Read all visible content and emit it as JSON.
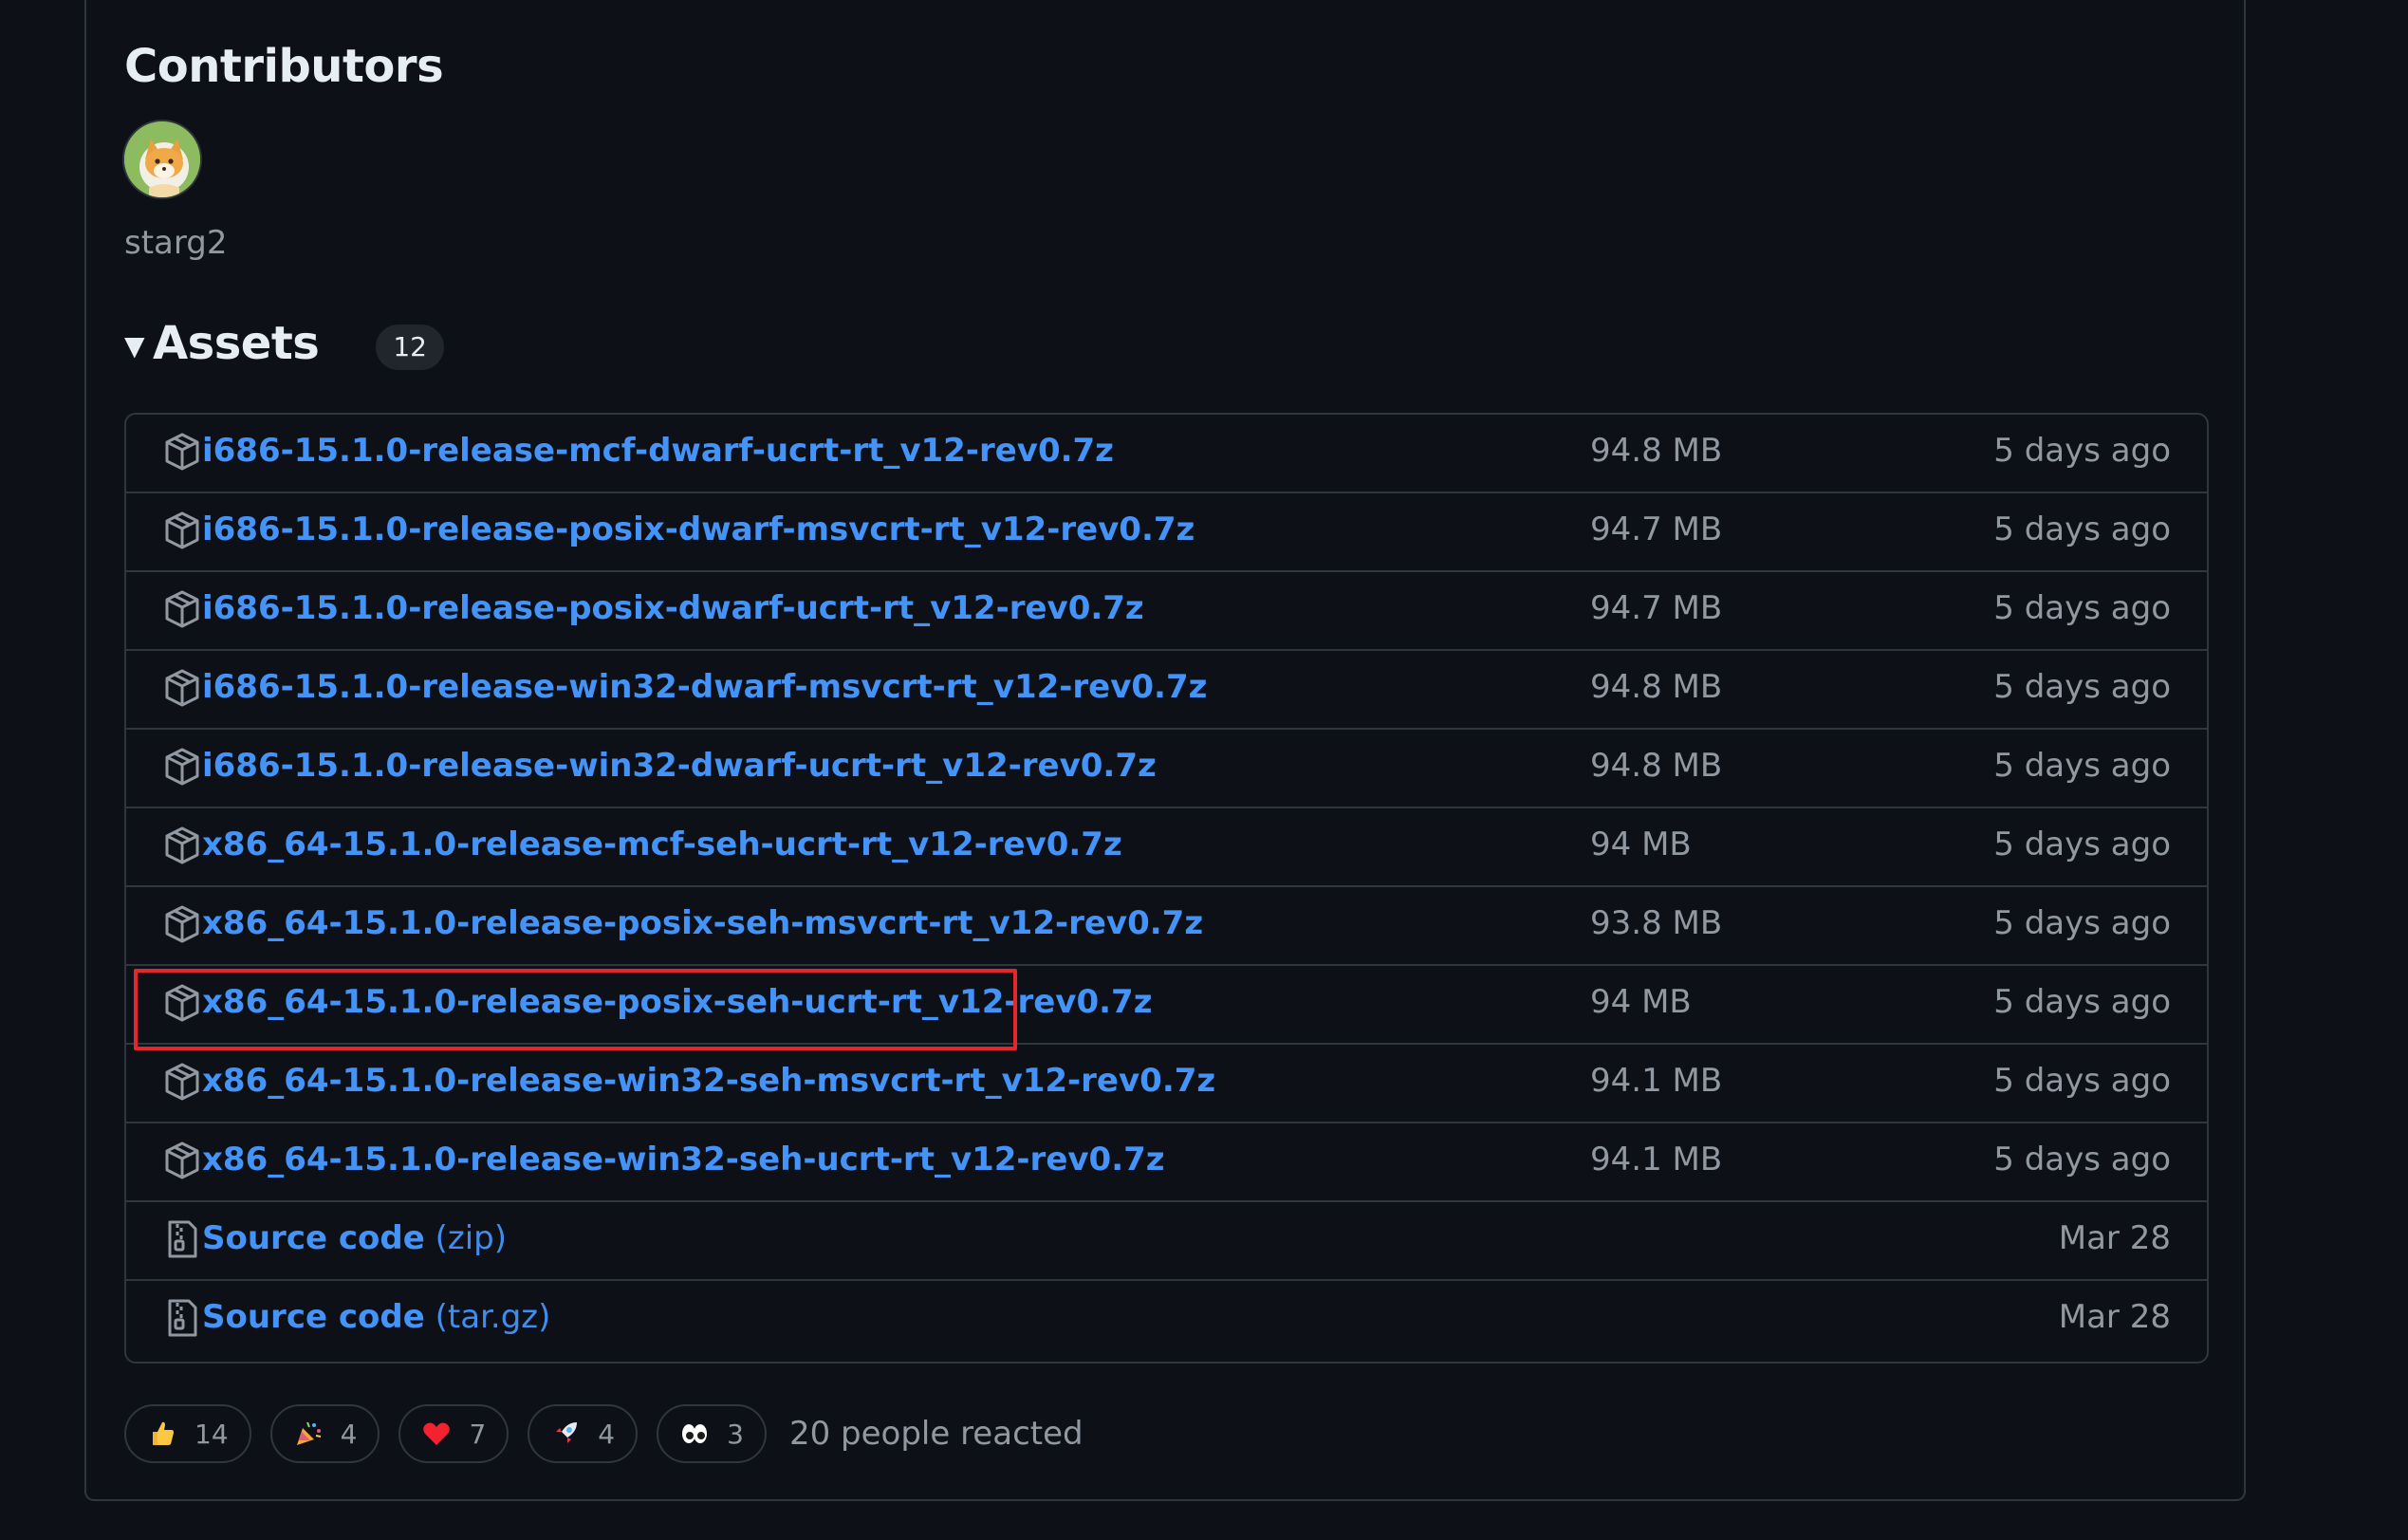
{
  "contributors": {
    "title": "Contributors",
    "users": [
      {
        "name": "starg2"
      }
    ]
  },
  "assets": {
    "title": "Assets",
    "count": "12",
    "items": [
      {
        "name": "i686-15.1.0-release-mcf-dwarf-ucrt-rt_v12-rev0.7z",
        "size": "94.8 MB",
        "date": "5 days ago",
        "icon": "package-icon"
      },
      {
        "name": "i686-15.1.0-release-posix-dwarf-msvcrt-rt_v12-rev0.7z",
        "size": "94.7 MB",
        "date": "5 days ago",
        "icon": "package-icon"
      },
      {
        "name": "i686-15.1.0-release-posix-dwarf-ucrt-rt_v12-rev0.7z",
        "size": "94.7 MB",
        "date": "5 days ago",
        "icon": "package-icon"
      },
      {
        "name": "i686-15.1.0-release-win32-dwarf-msvcrt-rt_v12-rev0.7z",
        "size": "94.8 MB",
        "date": "5 days ago",
        "icon": "package-icon"
      },
      {
        "name": "i686-15.1.0-release-win32-dwarf-ucrt-rt_v12-rev0.7z",
        "size": "94.8 MB",
        "date": "5 days ago",
        "icon": "package-icon"
      },
      {
        "name": "x86_64-15.1.0-release-mcf-seh-ucrt-rt_v12-rev0.7z",
        "size": "94 MB",
        "date": "5 days ago",
        "icon": "package-icon"
      },
      {
        "name": "x86_64-15.1.0-release-posix-seh-msvcrt-rt_v12-rev0.7z",
        "size": "93.8 MB",
        "date": "5 days ago",
        "icon": "package-icon"
      },
      {
        "name": "x86_64-15.1.0-release-posix-seh-ucrt-rt_v12-rev0.7z",
        "size": "94 MB",
        "date": "5 days ago",
        "icon": "package-icon",
        "highlighted": true
      },
      {
        "name": "x86_64-15.1.0-release-win32-seh-msvcrt-rt_v12-rev0.7z",
        "size": "94.1 MB",
        "date": "5 days ago",
        "icon": "package-icon"
      },
      {
        "name": "x86_64-15.1.0-release-win32-seh-ucrt-rt_v12-rev0.7z",
        "size": "94.1 MB",
        "date": "5 days ago",
        "icon": "package-icon"
      }
    ],
    "source": [
      {
        "name": "Source code",
        "suffix": "(zip)",
        "date": "Mar 28",
        "icon": "file-zip-icon"
      },
      {
        "name": "Source code",
        "suffix": "(tar.gz)",
        "date": "Mar 28",
        "icon": "file-zip-icon"
      }
    ]
  },
  "reactions": {
    "items": [
      {
        "emoji": "thumbs-up",
        "count": "14"
      },
      {
        "emoji": "tada",
        "count": "4"
      },
      {
        "emoji": "heart",
        "count": "7"
      },
      {
        "emoji": "rocket",
        "count": "4"
      },
      {
        "emoji": "eyes",
        "count": "3"
      }
    ],
    "summary": "20 people reacted"
  },
  "colors": {
    "background": "#0d1117",
    "border": "#30363d",
    "link": "#4493f8",
    "muted": "#9198a1",
    "highlight": "#e5262a"
  }
}
